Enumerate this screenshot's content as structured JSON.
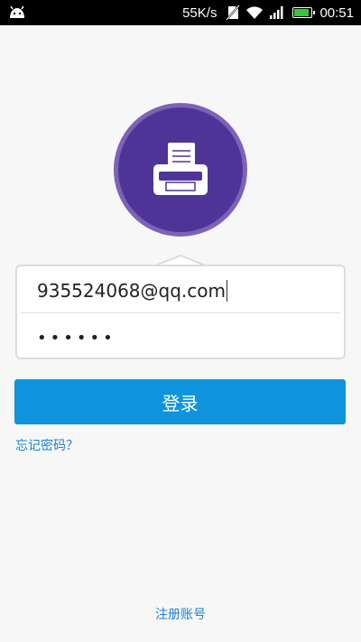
{
  "status_bar": {
    "net_speed": "55K/s",
    "time": "00:51",
    "battery_level": 0.9,
    "battery_color": "#35c935",
    "icons": [
      "android-icon",
      "no-sim-icon",
      "wifi-icon",
      "signal-icon",
      "battery-icon"
    ]
  },
  "logo": {
    "icon": "printer-icon",
    "bg_color": "#4f3497",
    "ring_color": "#7c63b8"
  },
  "login_form": {
    "username_value": "935524068@qq.com",
    "password_value": "••••••"
  },
  "login_button": {
    "label": "登录",
    "color": "#0e94dd"
  },
  "forgot_password": "忘记密码？",
  "register": "注册账号"
}
